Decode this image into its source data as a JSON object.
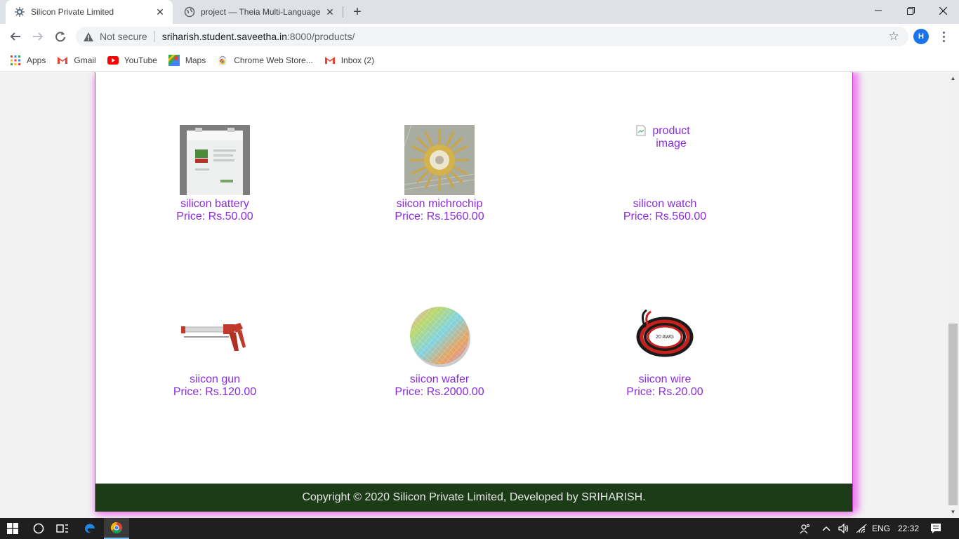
{
  "browser": {
    "tabs": [
      {
        "title": "Silicon Private Limited",
        "active": true
      },
      {
        "title": "project — Theia Multi-Language",
        "active": false
      }
    ],
    "address": {
      "security_label": "Not secure",
      "host": "sriharish.student.saveetha.in",
      "path": ":8000/products/"
    },
    "profile_initial": "H",
    "bookmarks": [
      {
        "label": "Apps",
        "icon": "apps-grid-icon"
      },
      {
        "label": "Gmail",
        "icon": "gmail-icon"
      },
      {
        "label": "YouTube",
        "icon": "youtube-icon"
      },
      {
        "label": "Maps",
        "icon": "maps-icon"
      },
      {
        "label": "Chrome Web Store...",
        "icon": "chrome-web-store-icon"
      },
      {
        "label": "Inbox (2)",
        "icon": "gmail-icon"
      }
    ]
  },
  "page": {
    "products": [
      {
        "name": "silicon battery",
        "price": "Price: Rs.50.00",
        "image": "battery"
      },
      {
        "name": "siicon michrochip",
        "price": "Price: Rs.1560.00",
        "image": "microchip"
      },
      {
        "name": "silicon watch",
        "price": "Price: Rs.560.00",
        "image": "broken",
        "alt": "product image"
      },
      {
        "name": "siicon gun",
        "price": "Price: Rs.120.00",
        "image": "gun"
      },
      {
        "name": "siicon wafer",
        "price": "Price: Rs.2000.00",
        "image": "wafer"
      },
      {
        "name": "siicon wire",
        "price": "Price: Rs.20.00",
        "image": "wire",
        "wire_label": "20 AWG"
      }
    ],
    "footer": "Copyright © 2020 Silicon Private Limited, Developed by SRIHARISH.",
    "colors": {
      "link": "#8a2be2",
      "footer_bg": "#1c3b17",
      "glow": "#ee82ee"
    }
  },
  "taskbar": {
    "language": "ENG",
    "time": "22:32"
  }
}
